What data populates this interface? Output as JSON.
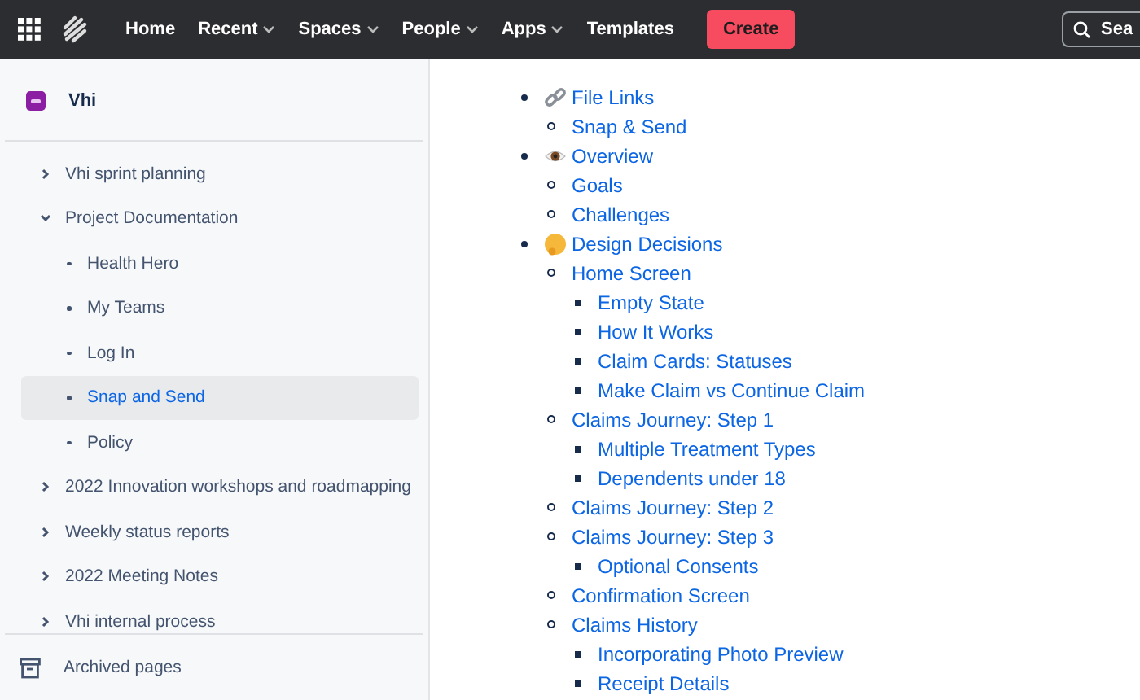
{
  "topbar": {
    "nav": [
      {
        "label": "Home",
        "dropdown": false
      },
      {
        "label": "Recent",
        "dropdown": true
      },
      {
        "label": "Spaces",
        "dropdown": true
      },
      {
        "label": "People",
        "dropdown": true
      },
      {
        "label": "Apps",
        "dropdown": true
      },
      {
        "label": "Templates",
        "dropdown": false
      }
    ],
    "create": "Create",
    "search": {
      "placeholder": "Sea"
    }
  },
  "sidebar": {
    "space": "Vhi",
    "items": [
      {
        "label": "Vhi sprint planning",
        "expanded": false,
        "selected": false
      },
      {
        "label": "Project Documentation",
        "expanded": true,
        "selected": false,
        "children": [
          {
            "label": "Health Hero",
            "selected": false
          },
          {
            "label": "My Teams",
            "selected": false
          },
          {
            "label": "Log In",
            "selected": false
          },
          {
            "label": "Snap and Send",
            "selected": true
          },
          {
            "label": "Policy",
            "selected": false
          }
        ]
      },
      {
        "label": "2022 Innovation workshops and roadmapping",
        "expanded": false,
        "selected": false
      },
      {
        "label": "Weekly status reports",
        "expanded": false,
        "selected": false
      },
      {
        "label": "2022 Meeting Notes",
        "expanded": false,
        "selected": false
      },
      {
        "label": "Vhi internal process",
        "expanded": false,
        "selected": false
      }
    ],
    "footer": "Archived pages"
  },
  "outline": [
    {
      "label": "File Links",
      "children": [
        {
          "label": "Snap & Send"
        }
      ]
    },
    {
      "label": "Overview",
      "children": [
        {
          "label": "Goals"
        },
        {
          "label": "Challenges"
        }
      ]
    },
    {
      "label": "Design Decisions",
      "children": [
        {
          "label": "Home Screen",
          "children": [
            {
              "label": "Empty State"
            },
            {
              "label": "How It Works"
            },
            {
              "label": "Claim Cards: Statuses"
            },
            {
              "label": "Make Claim vs Continue Claim"
            }
          ]
        },
        {
          "label": "Claims Journey: Step 1",
          "children": [
            {
              "label": "Multiple Treatment Types"
            },
            {
              "label": "Dependents under 18"
            }
          ]
        },
        {
          "label": "Claims Journey: Step 2"
        },
        {
          "label": "Claims Journey: Step 3",
          "children": [
            {
              "label": "Optional Consents"
            }
          ]
        },
        {
          "label": "Confirmation Screen"
        },
        {
          "label": "Claims History",
          "children": [
            {
              "label": "Incorporating Photo Preview"
            },
            {
              "label": "Receipt Details"
            }
          ]
        }
      ]
    }
  ]
}
